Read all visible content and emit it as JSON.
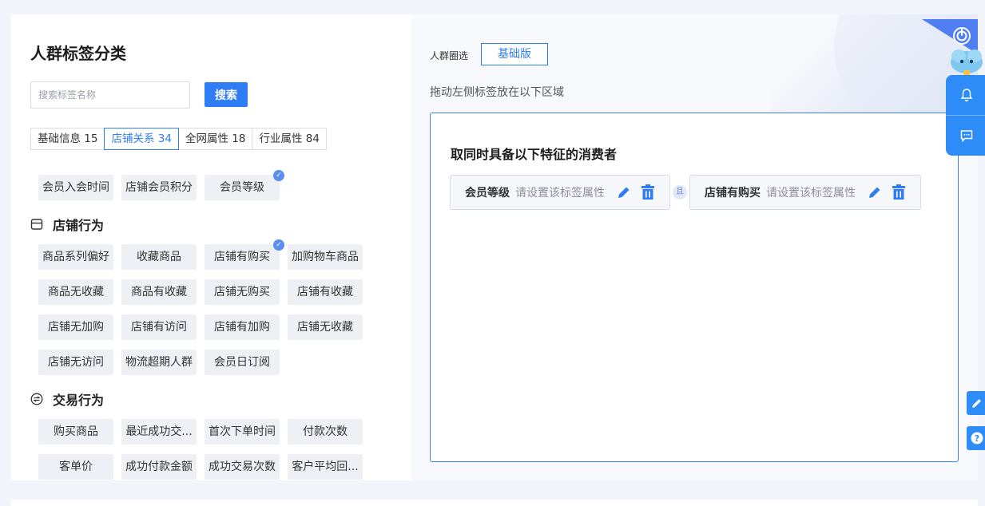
{
  "left": {
    "title": "人群标签分类",
    "search": {
      "placeholder": "搜索标签名称",
      "value": "",
      "button": "搜索"
    },
    "tabs": [
      {
        "label": "基础信息 15",
        "active": false
      },
      {
        "label": "店铺关系 34",
        "active": true
      },
      {
        "label": "全网属性 18",
        "active": false
      },
      {
        "label": "行业属性 84",
        "active": false
      }
    ],
    "member_tags": [
      {
        "label": "会员入会时间",
        "selected": false
      },
      {
        "label": "店铺会员积分",
        "selected": false
      },
      {
        "label": "会员等级",
        "selected": true
      }
    ],
    "sections": [
      {
        "title": "店铺行为",
        "icon": "store-icon",
        "tags": [
          {
            "label": "商品系列偏好",
            "selected": false
          },
          {
            "label": "收藏商品",
            "selected": false
          },
          {
            "label": "店铺有购买",
            "selected": true
          },
          {
            "label": "加购物车商品",
            "selected": false
          },
          {
            "label": "商品无收藏",
            "selected": false
          },
          {
            "label": "商品有收藏",
            "selected": false
          },
          {
            "label": "店铺无购买",
            "selected": false
          },
          {
            "label": "店铺有收藏",
            "selected": false
          },
          {
            "label": "店铺无加购",
            "selected": false
          },
          {
            "label": "店铺有访问",
            "selected": false
          },
          {
            "label": "店铺有加购",
            "selected": false
          },
          {
            "label": "店铺无收藏",
            "selected": false
          },
          {
            "label": "店铺无访问",
            "selected": false
          },
          {
            "label": "物流超期人群",
            "selected": false
          },
          {
            "label": "会员日订阅",
            "selected": false
          }
        ]
      },
      {
        "title": "交易行为",
        "icon": "exchange-icon",
        "tags": [
          {
            "label": "购买商品",
            "selected": false
          },
          {
            "label": "最近成功交...",
            "selected": false
          },
          {
            "label": "首次下单时间",
            "selected": false
          },
          {
            "label": "付款次数",
            "selected": false
          },
          {
            "label": "客单价",
            "selected": false
          },
          {
            "label": "成功付款金额",
            "selected": false
          },
          {
            "label": "成功交易次数",
            "selected": false
          },
          {
            "label": "客户平均回...",
            "selected": false
          }
        ]
      }
    ]
  },
  "right": {
    "mode_label": "人群圈选",
    "mode_button": "基础版",
    "drag_hint": "拖动左侧标签放在以下区域",
    "drop_title": "取同时具备以下特征的消费者",
    "conditions": [
      {
        "name": "会员等级",
        "placeholder": "请设置该标签属性"
      },
      {
        "name": "店铺有购买",
        "placeholder": "请设置该标签属性"
      }
    ],
    "connector": "且"
  },
  "floating": {
    "items": [
      {
        "icon": "bell-icon"
      },
      {
        "icon": "chat-icon"
      }
    ],
    "side_buttons": [
      {
        "icon": "edit-icon"
      },
      {
        "icon": "help-icon"
      }
    ]
  },
  "colors": {
    "accent": "#2f7df6",
    "chip_bg": "#eef0f6",
    "float_blue": "#2d8cf8",
    "check_badge": "#5c8df0"
  }
}
